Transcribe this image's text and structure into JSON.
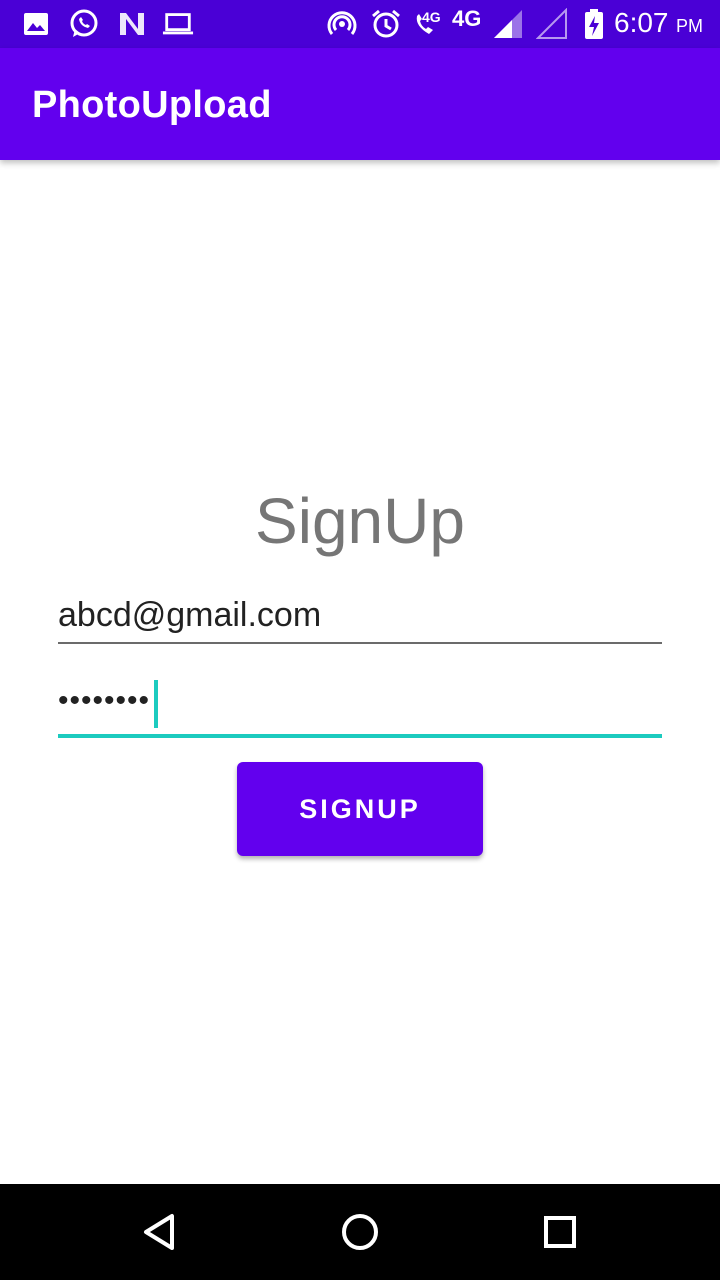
{
  "status_bar": {
    "time": "6:07",
    "ampm": "PM",
    "volte_label": "4G",
    "network_label": "4G",
    "icons": [
      "gallery-icon",
      "whatsapp-icon",
      "n-app-icon",
      "laptop-icon",
      "hotspot-icon",
      "alarm-icon",
      "volte-call-icon",
      "signal-icon",
      "signal-empty-icon",
      "battery-charging-icon"
    ]
  },
  "app_bar": {
    "title": "PhotoUpload"
  },
  "form": {
    "title": "SignUp",
    "email_value": "abcd@gmail.com",
    "password_value": "••••••••",
    "signup_label": "SIGNUP"
  },
  "colors": {
    "status_bar": "#4a00d6",
    "primary": "#6200ee",
    "accent": "#1ccbbf",
    "title_gray": "#767676"
  },
  "nav_bar": {
    "icons": [
      "back-icon",
      "home-icon",
      "recents-icon"
    ]
  }
}
